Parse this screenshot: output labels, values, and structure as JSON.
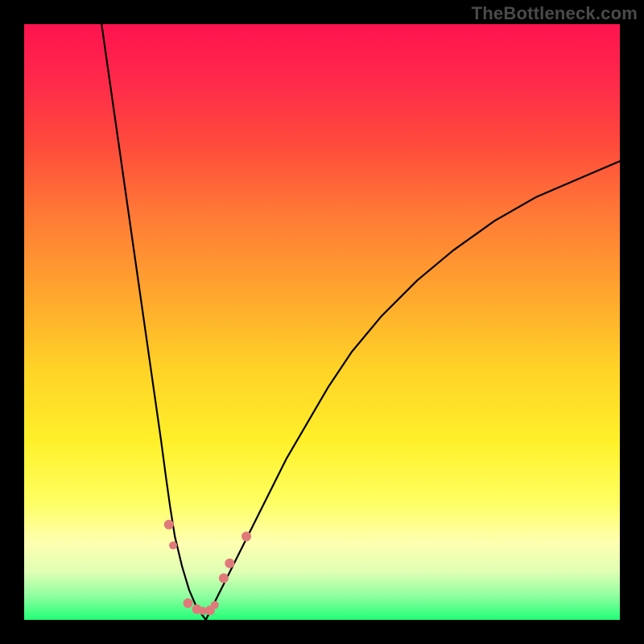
{
  "watermark": "TheBottleneck.com",
  "gradient": {
    "stops": [
      {
        "offset": 0.0,
        "color": "#ff134f"
      },
      {
        "offset": 0.1,
        "color": "#ff2b4a"
      },
      {
        "offset": 0.2,
        "color": "#ff4a3c"
      },
      {
        "offset": 0.32,
        "color": "#ff7a36"
      },
      {
        "offset": 0.45,
        "color": "#ffa52e"
      },
      {
        "offset": 0.58,
        "color": "#ffd327"
      },
      {
        "offset": 0.7,
        "color": "#fff02a"
      },
      {
        "offset": 0.8,
        "color": "#ffff60"
      },
      {
        "offset": 0.87,
        "color": "#ffffb0"
      },
      {
        "offset": 0.92,
        "color": "#dfffb5"
      },
      {
        "offset": 0.96,
        "color": "#8fffa0"
      },
      {
        "offset": 1.0,
        "color": "#22ff77"
      }
    ]
  },
  "chart_data": {
    "type": "line",
    "title": "",
    "xlabel": "",
    "ylabel": "",
    "xlim": [
      0,
      100
    ],
    "ylim": [
      0,
      100
    ],
    "series": [
      {
        "name": "left-curve",
        "x": [
          13,
          14,
          15,
          16,
          17,
          18,
          19,
          20,
          21,
          22,
          23,
          23.8,
          24.5,
          25.3,
          26.5,
          27.7,
          29,
          30.5
        ],
        "y": [
          100,
          93,
          86,
          79,
          72,
          65,
          58,
          51,
          44,
          37,
          30,
          24,
          19,
          14,
          9,
          5,
          2,
          0
        ]
      },
      {
        "name": "right-curve",
        "x": [
          30.5,
          32,
          34,
          36,
          38.5,
          41,
          44,
          47.5,
          51,
          55,
          60,
          66,
          72,
          79,
          86,
          93,
          100
        ],
        "y": [
          0,
          3,
          7,
          11,
          16,
          21,
          27,
          33,
          39,
          45,
          51,
          57,
          62,
          67,
          71,
          74,
          77
        ]
      }
    ],
    "points": [
      {
        "x": 24.3,
        "y": 16.0,
        "r": 6
      },
      {
        "x": 25.0,
        "y": 12.5,
        "r": 5
      },
      {
        "x": 27.5,
        "y": 2.8,
        "r": 6
      },
      {
        "x": 29.0,
        "y": 1.8,
        "r": 6
      },
      {
        "x": 30.0,
        "y": 1.5,
        "r": 5
      },
      {
        "x": 31.2,
        "y": 1.6,
        "r": 6
      },
      {
        "x": 32.0,
        "y": 2.5,
        "r": 5
      },
      {
        "x": 33.5,
        "y": 7.0,
        "r": 6
      },
      {
        "x": 34.5,
        "y": 9.5,
        "r": 6
      },
      {
        "x": 37.3,
        "y": 14.0,
        "r": 6
      }
    ]
  }
}
